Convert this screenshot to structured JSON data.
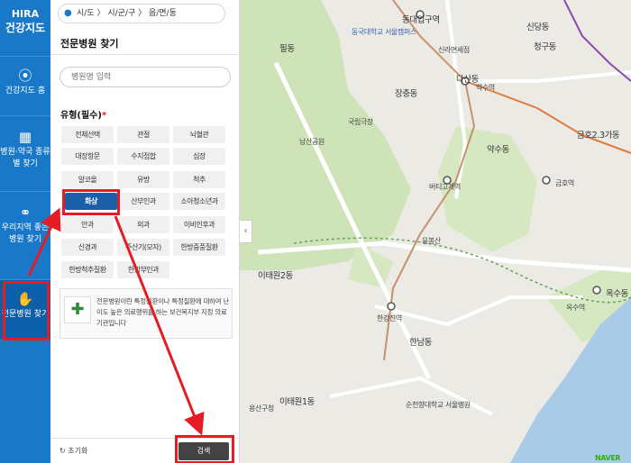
{
  "logo": {
    "line1": "HIRA",
    "line2": "건강지도"
  },
  "nav": {
    "items": [
      {
        "label": "건강지도 홈",
        "icon": "location-pin-icon"
      },
      {
        "label": "병원·약국 종류별 찾기",
        "icon": "hospital-building-icon"
      },
      {
        "label": "우리지역 좋은병원 찾기",
        "icon": "binoculars-icon"
      },
      {
        "label": "전문병원 찾기",
        "icon": "handshake-icon"
      }
    ]
  },
  "panel": {
    "region_selector": "시/도 〉 시/군/구 〉 읍/면/동",
    "title": "전문병원 찾기",
    "search_placeholder": "병원명 입력",
    "type_label": "유형(필수)",
    "type_required_mark": "*",
    "types": [
      "전체선택",
      "관절",
      "뇌혈관",
      "대장항문",
      "수지접합",
      "심장",
      "알코올",
      "유방",
      "척추",
      "화상",
      "산부인과",
      "소아청소년과",
      "안과",
      "외과",
      "이비인후과",
      "신경과",
      "주산기(모자)",
      "한방중풍질환",
      "한방척추질환",
      "한방부인과"
    ],
    "selected_type": "화상",
    "info_text": "전문병원이란 특정질환이나 특정질환에 대하여 난이도 높은 의료행위를 하는 보건복지부 지정 의료 기관입니다",
    "reset_label": "초기화",
    "search_button": "검색"
  },
  "map": {
    "labels": [
      {
        "text": "동대입구역"
      },
      {
        "text": "신당동"
      },
      {
        "text": "청구동"
      },
      {
        "text": "필동"
      },
      {
        "text": "동국대학교 서울캠퍼스"
      },
      {
        "text": "신라면세점"
      },
      {
        "text": "다산동"
      },
      {
        "text": "약수역"
      },
      {
        "text": "장충동"
      },
      {
        "text": "국립극장"
      },
      {
        "text": "남산공원"
      },
      {
        "text": "금호2.3가동"
      },
      {
        "text": "약수동"
      },
      {
        "text": "버티고개역"
      },
      {
        "text": "금호역"
      },
      {
        "text": "응봉산"
      },
      {
        "text": "이태원2동"
      },
      {
        "text": "한강진역"
      },
      {
        "text": "한남동"
      },
      {
        "text": "이태원1동"
      },
      {
        "text": "옥수동"
      },
      {
        "text": "옥수역"
      },
      {
        "text": "순천향대학교 서울병원"
      },
      {
        "text": "용산구청"
      },
      {
        "text": "NAVER"
      }
    ]
  }
}
